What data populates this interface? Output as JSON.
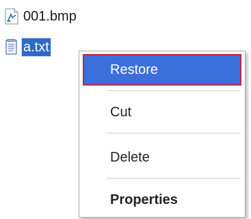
{
  "files": [
    {
      "name": "001.bmp",
      "icon": "bitmap-file-icon",
      "selected": false
    },
    {
      "name": "a.txt",
      "icon": "text-file-icon",
      "selected": true
    }
  ],
  "context_menu": {
    "items": [
      {
        "label": "Restore",
        "highlighted": true
      },
      {
        "label": "Cut"
      },
      {
        "label": "Delete"
      },
      {
        "label": "Properties",
        "bold": true
      }
    ]
  },
  "colors": {
    "selection": "#316ac5",
    "menu_highlight": "#3b6fdc",
    "focus_border": "#c0204a"
  }
}
